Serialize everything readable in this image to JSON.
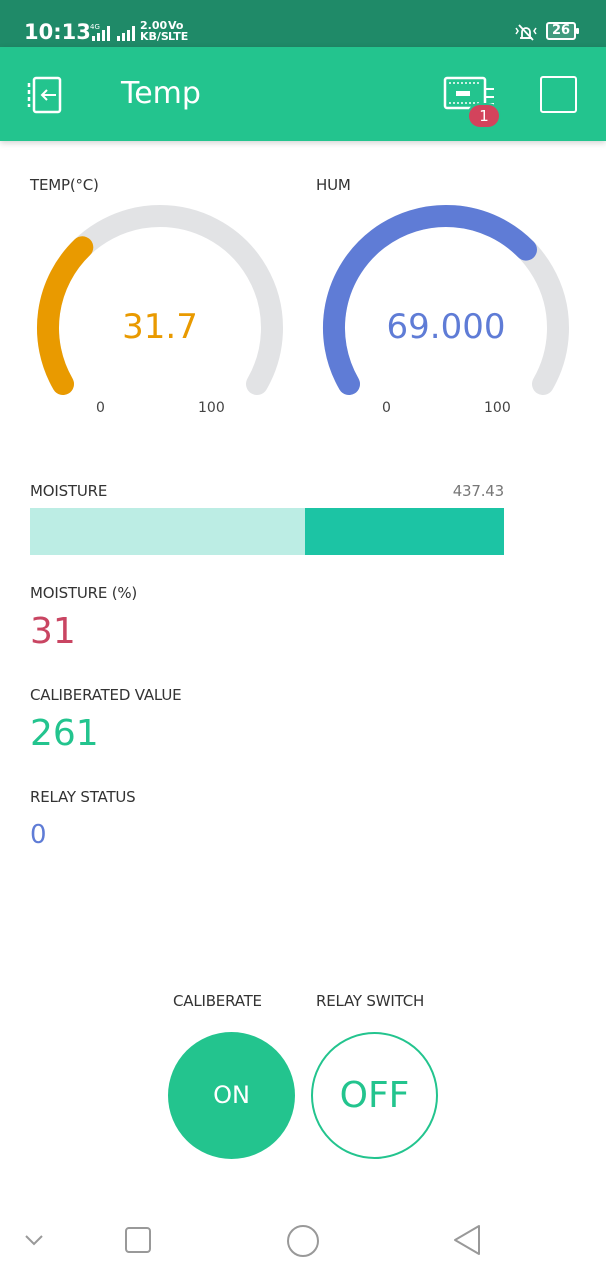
{
  "status_bar": {
    "time": "10:13",
    "network": "4G",
    "speed": "2.00\nKB/S",
    "lte": "Vo\nLTE",
    "battery": "26",
    "icons": [
      "signal-icon",
      "vibrate-icon",
      "battery-icon"
    ]
  },
  "app_bar": {
    "title": "Temp",
    "device_badge": "1",
    "background": "#23c48e",
    "icons": [
      "back-icon",
      "device-icon",
      "square-icon"
    ]
  },
  "widgets": {
    "temp_gauge": {
      "label": "TEMP(°C)",
      "value": "31.7",
      "min": "0",
      "max": "100",
      "level": 31.7,
      "color": "#e99a00"
    },
    "hum_gauge": {
      "label": "HUM",
      "value": "69.000",
      "min": "0",
      "max": "100",
      "level": 69.0,
      "color": "#5f7cd6"
    },
    "moisture": {
      "label": "MOISTURE",
      "value": "437.43",
      "fill_fraction": 0.42,
      "color": "#1cc4a4",
      "track_color": "#bcede4"
    },
    "moisture_pct": {
      "label": "MOISTURE (%)",
      "value": "31",
      "color": "#c94562"
    },
    "calibrated": {
      "label": "CALIBERATED VALUE",
      "value": "261",
      "color": "#23c48e"
    },
    "relay_status": {
      "label": "RELAY STATUS",
      "value": "0",
      "color": "#5f7cd6"
    }
  },
  "controls": {
    "calibrate": {
      "label": "CALIBERATE",
      "state": "ON"
    },
    "relay_switch": {
      "label": "RELAY SWITCH",
      "state": "OFF"
    }
  },
  "nav_bar": {
    "icons": [
      "chevron-down-icon",
      "recents-icon",
      "home-icon",
      "back-triangle-icon"
    ]
  }
}
